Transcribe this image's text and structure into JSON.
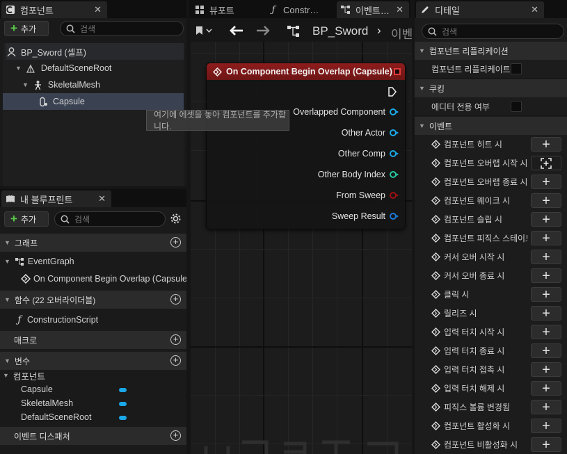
{
  "components_panel": {
    "tab_label": "컴포넌트",
    "add_label": "추가",
    "search_placeholder": "검색",
    "tree": [
      {
        "label": "BP_Sword (셀프)"
      },
      {
        "label": "DefaultSceneRoot"
      },
      {
        "label": "SkeletalMesh"
      },
      {
        "label": "Capsule"
      }
    ],
    "tooltip": "여기에 에셋을 놓아 컴포넌트를 추가합니다."
  },
  "blueprint_panel": {
    "tab_label": "내 블루프린트",
    "add_label": "추가",
    "search_placeholder": "검색",
    "sections": {
      "graph": "그래프",
      "event_graph": "EventGraph",
      "event_node": "On Component Begin Overlap (Capsule)",
      "functions": "함수 (22 오버라이더블)",
      "construction_script": "ConstructionScript",
      "macros": "매크로",
      "variables": "변수",
      "components": "컴포넌트",
      "var_items": [
        "Capsule",
        "SkeletalMesh",
        "DefaultSceneRoot"
      ],
      "event_dispatchers": "이벤트 디스패처"
    }
  },
  "center_tabs": {
    "viewport": "뷰포트",
    "construction": "Constr…",
    "event_graph": "이벤트…"
  },
  "graph_toolbar": {
    "breadcrumb_root": "BP_Sword",
    "breadcrumb_next": "이벤"
  },
  "node": {
    "title": "On Component Begin Overlap (Capsule)",
    "pins": [
      {
        "label": "Overlapped Component",
        "color": "#1aa8e8"
      },
      {
        "label": "Other Actor",
        "color": "#1aa8e8"
      },
      {
        "label": "Other Comp",
        "color": "#1aa8e8"
      },
      {
        "label": "Other Body Index",
        "color": "#27c8a0"
      },
      {
        "label": "From Sweep",
        "color": "#9c1010"
      },
      {
        "label": "Sweep Result",
        "color": "#1a7ad8"
      }
    ],
    "header_color": "#8e1c1c"
  },
  "details_panel": {
    "tab_label": "디테일",
    "search_placeholder": "검색",
    "replication_section": "컴포넌트 리플리케이션",
    "replicates_label": "컴포넌트 리플리케이트",
    "cooking_section": "쿠킹",
    "editor_only_label": "에디터 전용 여부",
    "events_section": "이벤트",
    "events": [
      "컴포넌트 히트 시",
      "컴포넌트 오버랩 시작 시",
      "컴포넌트 오버랩 종료 시",
      "컴포넌트 웨이크 시",
      "컴포넌트 슬립 시",
      "컴포넌트 피직스 스테이트 변",
      "커서 오버 시작 시",
      "커서 오버 종료 시",
      "클릭 시",
      "릴리즈 시",
      "입력 터치 시작 시",
      "입력 터치 종료 시",
      "입력 터치 접촉 시",
      "입력 터치 해제 시",
      "피직스 볼륨 변경됨",
      "컴포넌트 활성화 시",
      "컴포넌트 비활성화 시"
    ]
  },
  "colors": {
    "accent_green": "#5ac94a",
    "variable_blue": "#1aa8e8",
    "selection": "#3a4252"
  }
}
